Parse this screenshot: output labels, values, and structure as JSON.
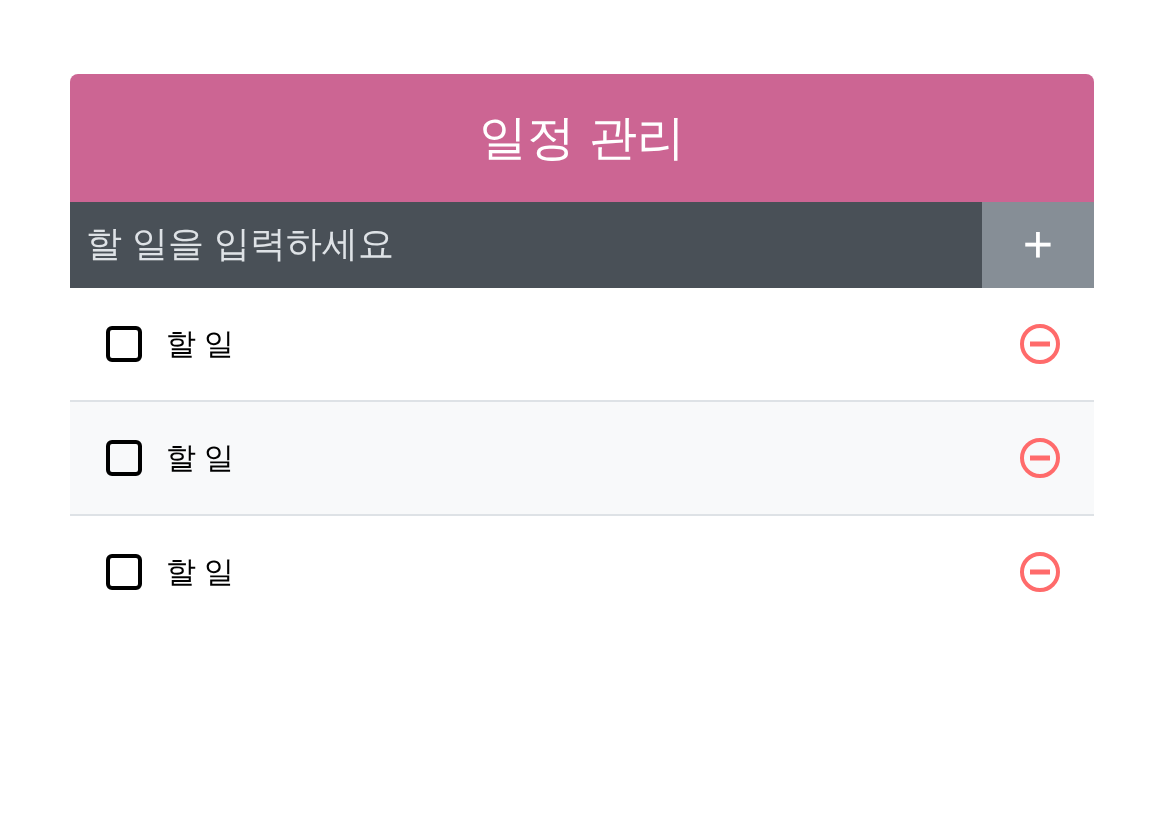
{
  "header": {
    "title": "일정 관리"
  },
  "insert": {
    "placeholder": "할 일을 입력하세요",
    "button": "+"
  },
  "todos": [
    {
      "text": "할 일",
      "checked": false
    },
    {
      "text": "할 일",
      "checked": false
    },
    {
      "text": "할 일",
      "checked": false
    }
  ]
}
